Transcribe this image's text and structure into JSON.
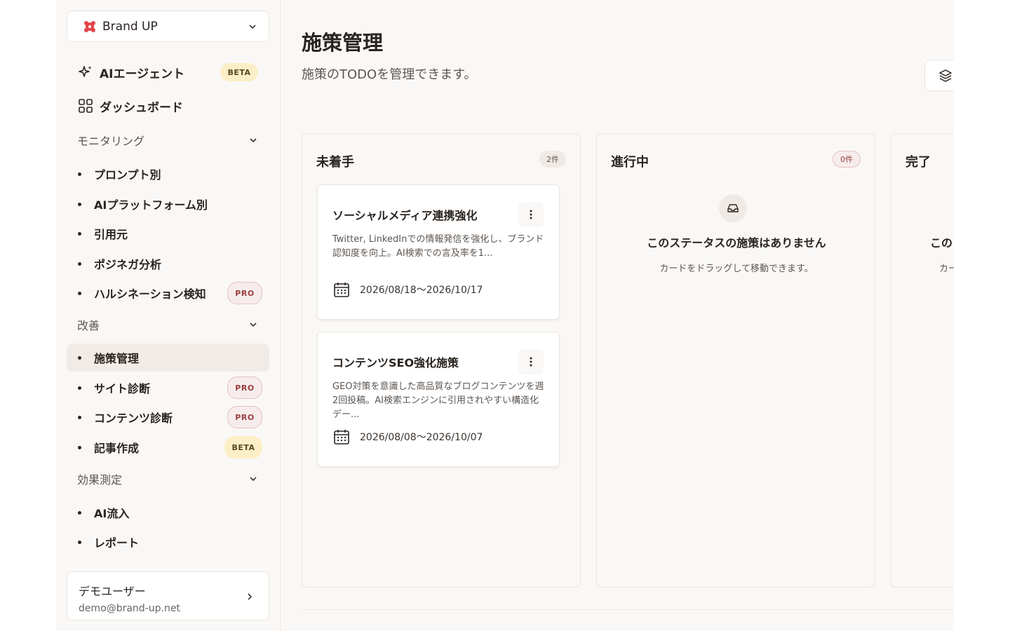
{
  "brand": {
    "name": "Brand UP"
  },
  "nav": {
    "ai_agent": {
      "label": "AIエージェント",
      "badge": "BETA"
    },
    "dashboard": {
      "label": "ダッシュボード"
    }
  },
  "sections": {
    "monitoring": {
      "label": "モニタリング",
      "items": [
        {
          "label": "プロンプト別"
        },
        {
          "label": "AIプラットフォーム別"
        },
        {
          "label": "引用元"
        },
        {
          "label": "ポジネガ分析"
        },
        {
          "label": "ハルシネーション検知",
          "badge": "PRO"
        }
      ]
    },
    "improve": {
      "label": "改善",
      "items": [
        {
          "label": "施策管理"
        },
        {
          "label": "サイト診断",
          "badge": "PRO"
        },
        {
          "label": "コンテンツ診断",
          "badge": "PRO"
        },
        {
          "label": "記事作成",
          "badge": "BETA"
        }
      ]
    },
    "measure": {
      "label": "効果測定",
      "items": [
        {
          "label": "AI流入"
        },
        {
          "label": "レポート"
        }
      ]
    }
  },
  "user": {
    "name": "デモユーザー",
    "email": "demo@brand-up.net"
  },
  "page": {
    "title": "施策管理",
    "subtitle": "施策のTODOを管理できます。"
  },
  "columns": [
    {
      "title": "未着手",
      "count": "2件",
      "cards": [
        {
          "title": "ソーシャルメディア連携強化",
          "description": "Twitter, LinkedInでの情報発信を強化し、ブランド認知度を向上。AI検索での言及率を1...",
          "date": "2026/08/18〜2026/10/17"
        },
        {
          "title": "コンテンツSEO強化施策",
          "description": "GEO対策を意識した高品質なブログコンテンツを週2回投稿。AI検索エンジンに引用されやすい構造化デー...",
          "date": "2026/08/08〜2026/10/07"
        }
      ]
    },
    {
      "title": "進行中",
      "count": "0件",
      "empty_title": "このステータスの施策はありません",
      "empty_sub": "カードをドラッグして移動できます。"
    },
    {
      "title": "完了",
      "empty_title": "この",
      "empty_sub": "カー"
    }
  ],
  "icons": {
    "brand": "brand-logo-icon",
    "ai": "sparkle-icon",
    "dashboard": "grid-icon",
    "chevron": "chevron-down-icon",
    "layers": "layers-icon",
    "menu": "kebab-icon",
    "calendar": "calendar-icon",
    "inbox": "inbox-icon"
  },
  "colors": {
    "background": "#faf8f6",
    "beta_badge": "#fcefc7",
    "pro_badge": "#f7ecec",
    "active_item": "#f0ebe6",
    "brand_logo": "#e0454a"
  }
}
